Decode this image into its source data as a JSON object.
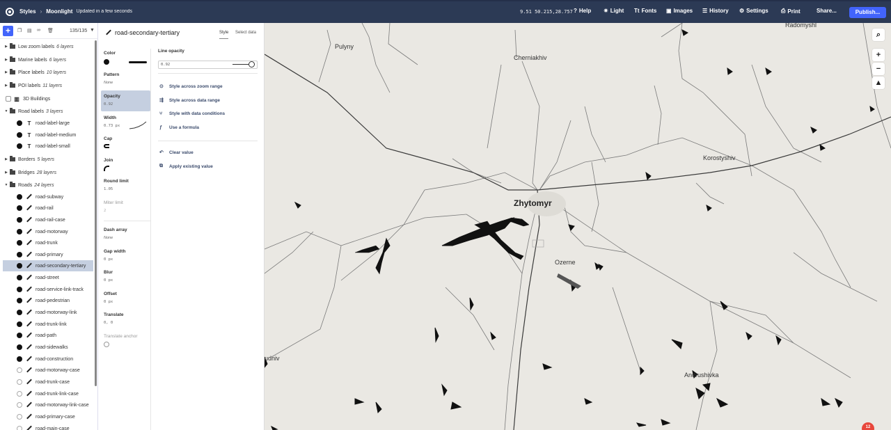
{
  "topbar": {
    "app_label": "Styles",
    "style_name": "Moonlight",
    "status": "Updated in a few seconds",
    "coords": "9.51 50.215,28.757",
    "menu": {
      "help": "Help",
      "light": "Light",
      "fonts": "Fonts",
      "images": "Images",
      "history": "History",
      "settings": "Settings",
      "print": "Print",
      "share": "Share...",
      "publish": "Publish..."
    }
  },
  "sidebar": {
    "add": "+",
    "count": "135/135",
    "groups": [
      {
        "label": "Low zoom labels",
        "count": "6 layers"
      },
      {
        "label": "Marine labels",
        "count": "6 layers"
      },
      {
        "label": "Place labels",
        "count": "10 layers"
      },
      {
        "label": "POI labels",
        "count": "11 layers"
      },
      {
        "label": "3D Buildings"
      },
      {
        "label": "Road labels",
        "count": "3 layers"
      },
      {
        "label": "Borders",
        "count": "5 layers"
      },
      {
        "label": "Bridges",
        "count": "28 layers"
      },
      {
        "label": "Roads",
        "count": "24 layers"
      }
    ],
    "road_label_layers": [
      "road-label-large",
      "road-label-medium",
      "road-label-small"
    ],
    "road_layers": [
      "road-subway",
      "road-rail",
      "road-rail-case",
      "road-motorway",
      "road-trunk",
      "road-primary",
      "road-secondary-tertiary",
      "road-street",
      "road-service-link-track",
      "road-pedestrian",
      "road-motorway-link",
      "road-trunk-link",
      "road-path",
      "road-sidewalks",
      "road-construction",
      "road-motorway-case",
      "road-trunk-case",
      "road-trunk-link-case",
      "road-motorway-link-case",
      "road-primary-case",
      "road-main-case"
    ]
  },
  "props": {
    "layer_name": "road-secondary-tertiary",
    "tabs": {
      "style": "Style",
      "select_data": "Select data"
    },
    "properties": {
      "color": {
        "label": "Color"
      },
      "pattern": {
        "label": "Pattern",
        "value": "None"
      },
      "opacity": {
        "label": "Opacity",
        "value": "0.92"
      },
      "width": {
        "label": "Width",
        "value": "0.73 px"
      },
      "cap": {
        "label": "Cap"
      },
      "join": {
        "label": "Join"
      },
      "round_limit": {
        "label": "Round limit",
        "value": "1.05"
      },
      "miter_limit": {
        "label": "Miter limit",
        "value": "2"
      },
      "dash_array": {
        "label": "Dash array",
        "value": "None"
      },
      "gap_width": {
        "label": "Gap width",
        "value": "0 px"
      },
      "blur": {
        "label": "Blur",
        "value": "0 px"
      },
      "offset": {
        "label": "Offset",
        "value": "0 px"
      },
      "translate": {
        "label": "Translate",
        "value": "0, 0"
      },
      "translate_anchor": {
        "label": "Translate anchor"
      }
    },
    "editor": {
      "title": "Line opacity",
      "value": "0.92",
      "options": [
        "Style across zoom range",
        "Style across data range",
        "Style with data conditions",
        "Use a formula"
      ],
      "actions": [
        "Clear value",
        "Apply existing value"
      ]
    }
  },
  "map": {
    "places": {
      "radomyshl": "Radomyshl",
      "pulyny": "Pulyny",
      "cherniakhiv": "Cherniakhiv",
      "korostyshiv": "Korostyshiv",
      "zhytomyr": "Zhytomyr",
      "ozerne": "Ozerne",
      "rudniv": "udniv",
      "andrushivka": "Andrushivka"
    },
    "badge": "12"
  },
  "colors": {
    "topbar": "#2c3a55",
    "accent": "#4264fb",
    "selected": "#c5cfe0",
    "map_bg": "#eae8e3",
    "road": "#333333",
    "water": "#111111"
  }
}
